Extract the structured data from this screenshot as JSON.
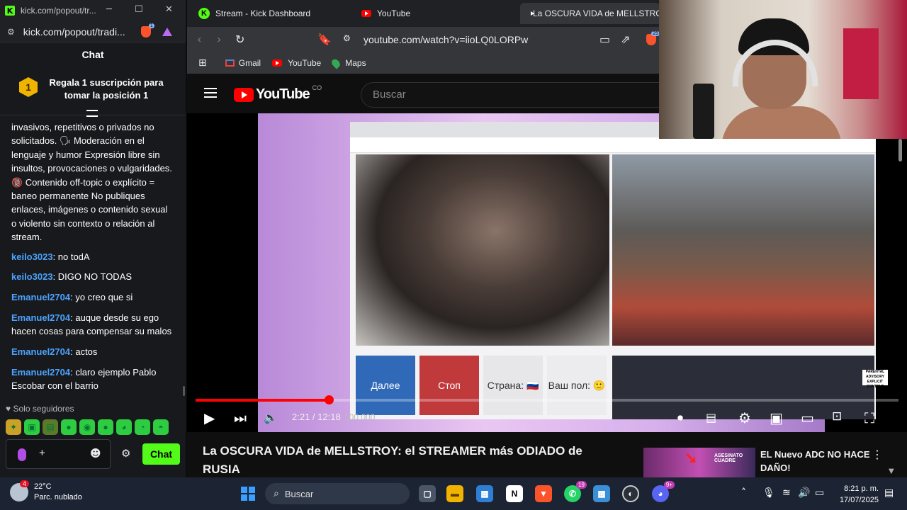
{
  "kick_window": {
    "title": "kick.com/popout/tr...",
    "url": "kick.com/popout/tradi...",
    "brave_badge": "1",
    "chat_header": "Chat",
    "pinned": {
      "rank": "1",
      "text": "Regala 1 suscripción para tomar la posición 1"
    },
    "rules_text": "invasivos, repetitivos o privados no solicitados. 🗣 Moderación en el lenguaje y humor Expresión libre sin insultos, provocaciones o vulgaridades. 🔞 Contenido off-topic o explícito = baneo permanente No publiques enlaces, imágenes o contenido sexual o violento sin contexto o relación al stream.",
    "messages": [
      {
        "user": "keilo3023",
        "text": ": no todA"
      },
      {
        "user": "keilo3023",
        "text": ": DIGO NO TODAS"
      },
      {
        "user": "Emanuel2704",
        "text": ": yo creo que si"
      },
      {
        "user": "Emanuel2704",
        "text": ": auque desde su ego hacen cosas para compensar su malos"
      },
      {
        "user": "Emanuel2704",
        "text": ": actos"
      },
      {
        "user": "Emanuel2704",
        "text": ": claro ejemplo Pablo Escobar con el barrio"
      }
    ],
    "followers_only": "Solo seguidores",
    "send_label": "Chat",
    "plus_label": "+"
  },
  "tabs": [
    {
      "label": "Stream - Kick Dashboard",
      "icon": "kick-favicon"
    },
    {
      "label": "YouTube",
      "icon": "youtube-favicon"
    },
    {
      "label": "La OSCURA VIDA de MELLSTROY",
      "icon": "youtube-favicon"
    }
  ],
  "address_bar": {
    "url": "youtube.com/watch?v=iioLQ0LORPw",
    "brave_badge": "25"
  },
  "bookmarks": [
    {
      "label": "Gmail"
    },
    {
      "label": "YouTube"
    },
    {
      "label": "Maps"
    }
  ],
  "youtube": {
    "logo_text": "YouTube",
    "country": "CO",
    "search_placeholder": "Buscar",
    "player": {
      "time": "2:21 / 12:18",
      "progress": 0.19,
      "buttons_in_video": [
        "Далее",
        "Стоп",
        "Страна: 🇷🇺",
        "Ваш пол: 🙂"
      ],
      "overlay_text": "100 000",
      "advisory": "PARENTAL ADVISORY EXPLICIT CONTENT"
    },
    "video_title": "La OSCURA VIDA de MELLSTROY: el STREAMER más ODIADO de RUSIA",
    "recommended": {
      "title": "EL Nuevo ADC NO HACE DAÑO!",
      "thumb_text": "ASESINATO CUADRE"
    }
  },
  "taskbar": {
    "weather": {
      "temp": "22°C",
      "desc": "Parc. nublado",
      "badge": "4"
    },
    "search_label": "Buscar",
    "whatsapp_badge": "19",
    "discord_badge": "9+",
    "time": "8:21 p. m.",
    "date": "17/07/2025"
  },
  "colors": {
    "kick_green": "#53fc18",
    "yt_red": "#ff0000",
    "chat_user": "#4ba3ff"
  }
}
